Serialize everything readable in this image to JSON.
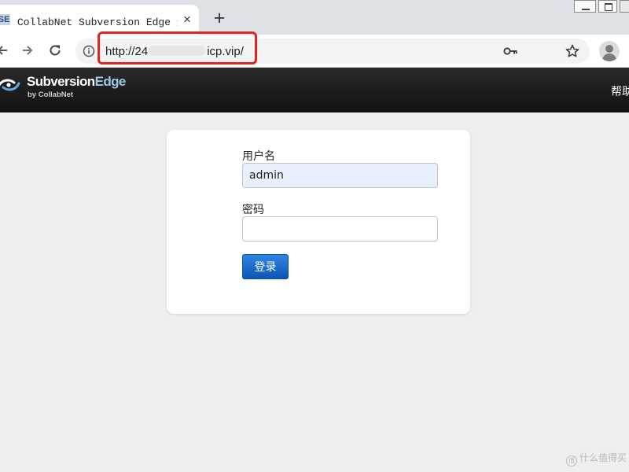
{
  "browser": {
    "tab": {
      "favicon_text": "SE",
      "title": "CollabNet Subversion Edge 登录",
      "close_glyph": "×"
    },
    "new_tab_glyph": "+",
    "url": {
      "prefix": "http://24",
      "suffix": "icp.vip/"
    }
  },
  "header": {
    "logo_name_main": "Subversion",
    "logo_name_accent": "Edge",
    "logo_sub": "by CollabNet",
    "help_label": "帮助"
  },
  "login": {
    "username_label": "用户名",
    "username_value": "admin",
    "password_label": "密码",
    "password_value": "",
    "submit_label": "登录"
  },
  "watermark": {
    "badge": "值",
    "text": "什么值得买"
  },
  "colors": {
    "header_bg": "#1a1a1a",
    "page_bg": "#efefef",
    "button_blue": "#1565c8",
    "autofill_bg": "#e8f0fe",
    "highlight_red": "#e3241b"
  },
  "icons": [
    "back-arrow-icon",
    "forward-arrow-icon",
    "reload-icon",
    "info-icon",
    "key-icon",
    "star-icon",
    "profile-icon",
    "subversion-edge-logo-icon"
  ]
}
